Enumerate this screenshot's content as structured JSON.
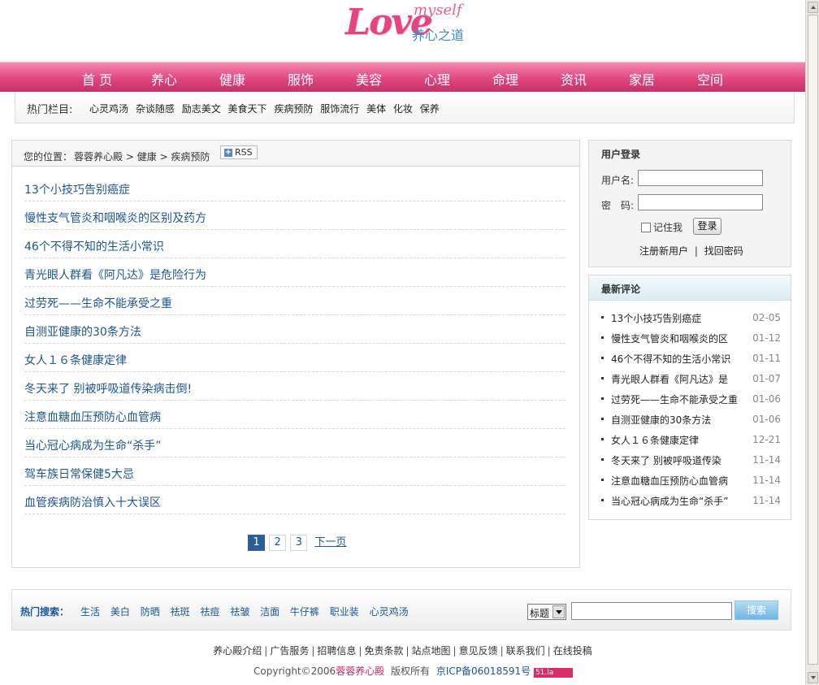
{
  "logo": {
    "love": "Love",
    "myself": "myself",
    "cn": "养心之道"
  },
  "nav": [
    "首 页",
    "养心",
    "健康",
    "服饰",
    "美容",
    "心理",
    "命理",
    "资讯",
    "家居",
    "空间"
  ],
  "hot": {
    "title": "热门栏目:",
    "links": [
      "心灵鸡汤",
      "杂谈随感",
      "励志美文",
      "美食天下",
      "疾病预防",
      "服饰流行",
      "美体",
      "化妆",
      "保养"
    ]
  },
  "breadcrumb": {
    "prefix": "您的位置：",
    "items": [
      "蓉蓉养心殿",
      "> 健康",
      "> 疾病预防"
    ],
    "rss": "RSS"
  },
  "articles": [
    "13个小技巧告别癌症",
    "慢性支气管炎和咽喉炎的区别及药方",
    "46个不得不知的生活小常识",
    "青光眼人群看《阿凡达》是危险行为",
    "过劳死——生命不能承受之重",
    "自测亚健康的30条方法",
    "女人１６条健康定律",
    "冬天来了 别被呼吸道传染病击倒!",
    "注意血糖血压预防心血管病",
    "当心冠心病成为生命“杀手”",
    "驾车族日常保健5大忌",
    "血管疾病防治慎入十大误区"
  ],
  "pager": {
    "pages": [
      "1",
      "2",
      "3"
    ],
    "next": "下一页"
  },
  "login": {
    "title": "用户登录",
    "username_label": "用户名:",
    "password_label": "密　码:",
    "remember": "记住我",
    "submit": "登录",
    "register": "注册新用户",
    "sep": "|",
    "forgot": "找回密码"
  },
  "comments": {
    "title": "最新评论",
    "items": [
      {
        "text": "13个小技巧告别癌症",
        "date": "02-05"
      },
      {
        "text": "慢性支气管炎和咽喉炎的区",
        "date": "01-12"
      },
      {
        "text": "46个不得不知的生活小常识",
        "date": "01-11"
      },
      {
        "text": "青光眼人群看《阿凡达》是",
        "date": "01-07"
      },
      {
        "text": "过劳死——生命不能承受之重",
        "date": "01-06"
      },
      {
        "text": "自测亚健康的30条方法",
        "date": "01-06"
      },
      {
        "text": "女人１６条健康定律",
        "date": "12-21"
      },
      {
        "text": "冬天来了 别被呼吸道传染",
        "date": "11-14"
      },
      {
        "text": "注意血糖血压预防心血管病",
        "date": "11-14"
      },
      {
        "text": "当心冠心病成为生命“杀手”",
        "date": "11-14"
      }
    ]
  },
  "search": {
    "label": "热门搜索：",
    "keywords": [
      "生活",
      "美白",
      "防晒",
      "祛斑",
      "祛痘",
      "祛皱",
      "洁面",
      "牛仔裤",
      "职业装",
      "心灵鸡汤"
    ],
    "select": "标题",
    "button": "搜索"
  },
  "footer": {
    "links": [
      "养心殿介绍",
      "广告服务",
      "招聘信息",
      "免责条款",
      "站点地图",
      "意见反馈",
      "联系我们",
      "在线投稿"
    ],
    "copyright": "Copyright©2006",
    "site": "蓉蓉养心殿",
    "rights": "版权所有",
    "icp": "京ICP备06018591号",
    "badge": "51.la"
  }
}
